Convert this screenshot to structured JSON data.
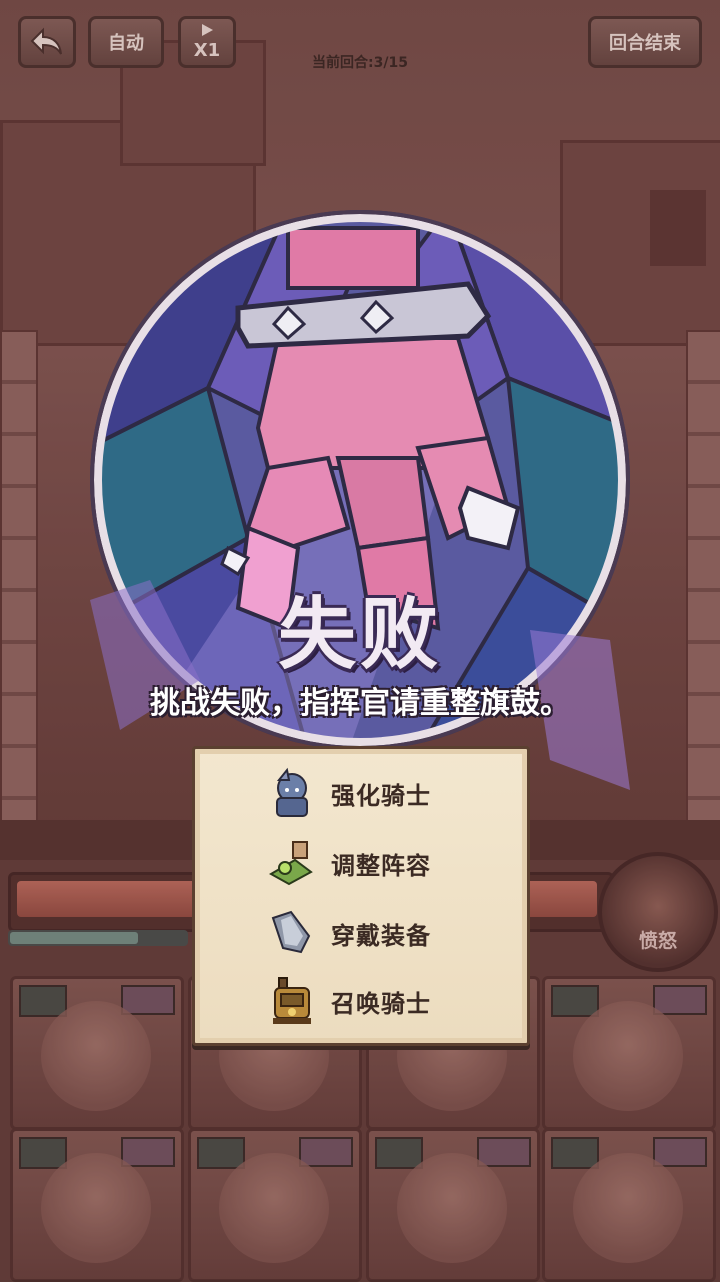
{
  "hud": {
    "back_icon": "back-arrow-icon",
    "auto_label": "自动",
    "speed_label": "X1",
    "speed_icon": "play-icon",
    "end_round_label": "回合结束",
    "round_info": "当前回合:3/15"
  },
  "result": {
    "title": "失败",
    "subtitle": "挑战失败，指挥官请重整旗鼓。"
  },
  "options": [
    {
      "label": "强化骑士",
      "icon": "knight-upgrade-icon"
    },
    {
      "label": "调整阵容",
      "icon": "formation-icon"
    },
    {
      "label": "穿戴装备",
      "icon": "equipment-icon"
    },
    {
      "label": "召唤骑士",
      "icon": "summon-train-icon"
    }
  ],
  "battle": {
    "rage_label": "愤怒"
  },
  "colors": {
    "title_fill": "#f2eaf3",
    "title_outline": "#3a2a55",
    "panel_bg": "#f3e7cf",
    "hud_bg": "#7d5853"
  }
}
